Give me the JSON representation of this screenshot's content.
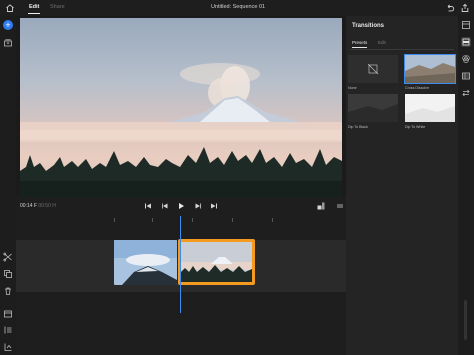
{
  "topbar": {
    "tabs": [
      {
        "label": "Edit",
        "active": true
      },
      {
        "label": "Share",
        "active": false
      }
    ],
    "title": "Untitled: Sequence 01",
    "icons": [
      "home-icon",
      "undo-icon",
      "share-icon"
    ]
  },
  "left_tools": {
    "add_label": "+",
    "icons": [
      "add-media-icon",
      "library-icon",
      "split-icon",
      "duplicate-icon",
      "delete-icon",
      "title-icon",
      "tracks-icon",
      "audio-icon"
    ]
  },
  "transport": {
    "current_time": "00:14",
    "current_frames": "F",
    "duration": "00:50",
    "duration_frames": "H",
    "controls": [
      "skip-to-start-icon",
      "step-back-icon",
      "play-icon",
      "step-forward-icon",
      "skip-to-end-icon"
    ]
  },
  "timeline": {
    "clips": [
      {
        "name": "clip-1",
        "selected": false
      },
      {
        "name": "clip-2",
        "selected": true
      }
    ],
    "selection_color": "#f39a1f",
    "playhead_color": "#3b8bf0"
  },
  "transitions_panel": {
    "title": "Transitions",
    "tabs": [
      {
        "label": "Presets",
        "active": true
      },
      {
        "label": "Edit",
        "active": false
      }
    ],
    "items": [
      {
        "label": "None",
        "selected": false
      },
      {
        "label": "Cross Dissolve",
        "selected": true
      },
      {
        "label": "Dip To Black",
        "selected": false
      },
      {
        "label": "Dip To White",
        "selected": false
      }
    ]
  },
  "right_tools": {
    "icons": [
      "properties-icon",
      "transitions-icon",
      "color-icon",
      "grid-icon",
      "transform-icon"
    ],
    "active": "transitions-icon"
  },
  "colors": {
    "accent": "#2d7df0",
    "background": "#1b1b1b",
    "panel": "#242424"
  }
}
